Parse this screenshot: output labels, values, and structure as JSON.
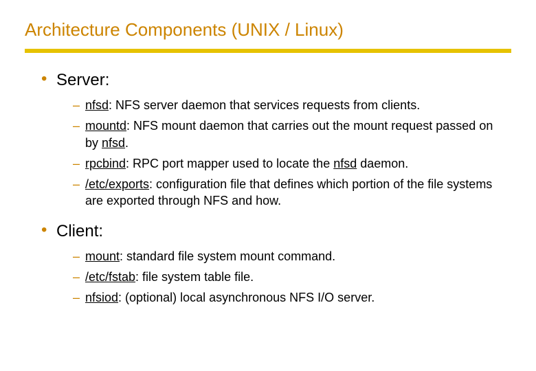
{
  "title": "Architecture Components (UNIX / Linux)",
  "sections": [
    {
      "heading": "Server:",
      "items": [
        {
          "term": "nfsd",
          "desc": ": NFS server daemon that services requests from clients."
        },
        {
          "term": "mountd",
          "desc": ": NFS mount daemon that carries out the mount request passed on by ",
          "trailing_term": "nfsd",
          "trailing": "."
        },
        {
          "term": "rpcbind",
          "desc": ": RPC port mapper used to locate the ",
          "trailing_term": "nfsd",
          "trailing": " daemon."
        },
        {
          "term": "/etc/exports",
          "desc": ": configuration file that defines which portion of the file systems are exported through NFS and how."
        }
      ]
    },
    {
      "heading": "Client:",
      "items": [
        {
          "term": "mount",
          "desc": ": standard file system mount command."
        },
        {
          "term": "/etc/fstab",
          "desc": ": file system table file."
        },
        {
          "term": "nfsiod",
          "desc": ": (optional) local asynchronous NFS I/O server."
        }
      ]
    }
  ]
}
